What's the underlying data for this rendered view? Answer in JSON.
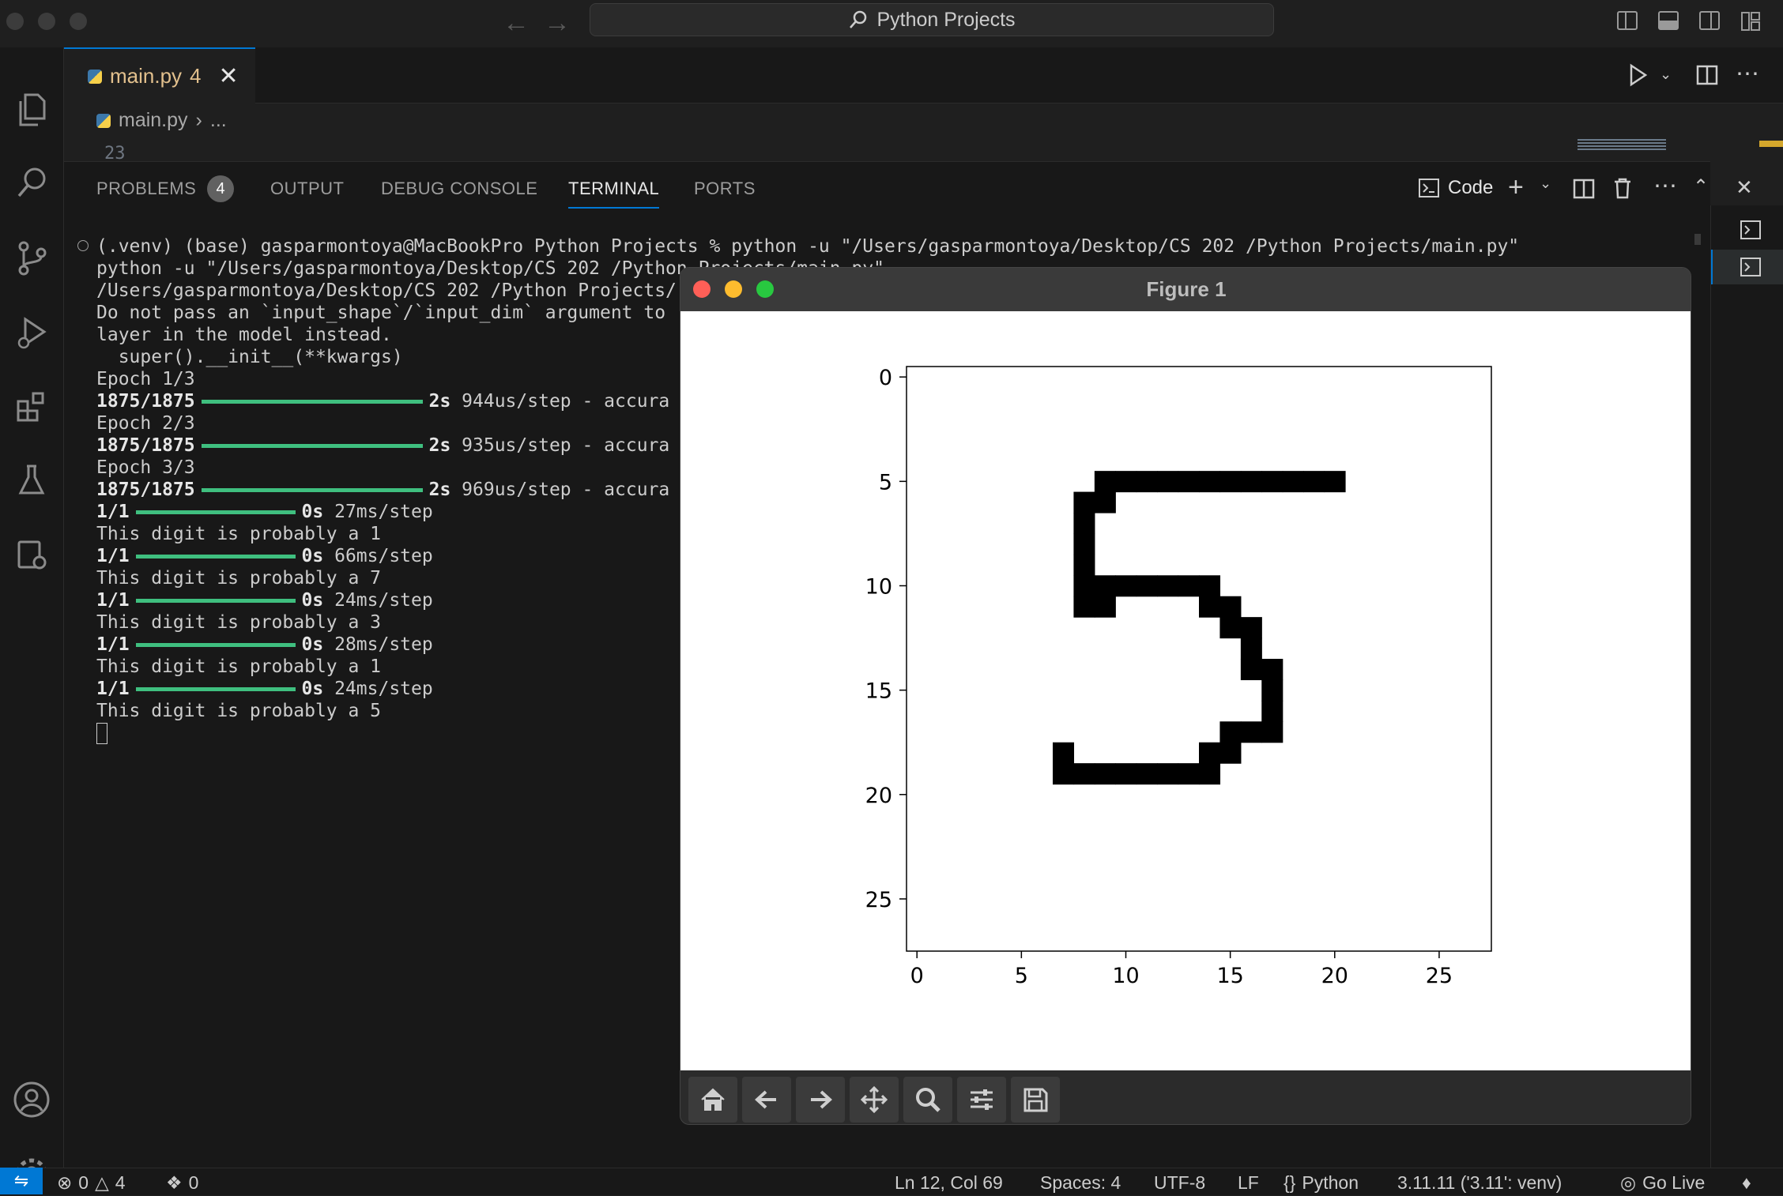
{
  "window": {
    "command_center": "Python Projects"
  },
  "editor": {
    "tab": {
      "label": "main.py",
      "problems": "4"
    },
    "breadcrumb": {
      "file": "main.py",
      "more": "..."
    },
    "line_number": "23"
  },
  "panel": {
    "tabs": [
      {
        "label": "PROBLEMS"
      },
      {
        "label": "OUTPUT"
      },
      {
        "label": "DEBUG CONSOLE"
      },
      {
        "label": "TERMINAL"
      },
      {
        "label": "PORTS"
      }
    ],
    "problems_count": "4",
    "terminal_profile": "Code",
    "terminal_lines": [
      {
        "text": "(.venv) (base) gasparmontoya@MacBookPro Python Projects % python -u \"/Users/gasparmontoya/Desktop/CS 202 /Python Projects/main.py\""
      },
      {
        "text": "python -u \"/Users/gasparmontoya/Desktop/CS 202 /Python Projects/main.py\""
      },
      {
        "text": "/Users/gasparmontoya/Desktop/CS 202 /Python Projects/"
      },
      {
        "text": "Do not pass an `input_shape`/`input_dim` argument to"
      },
      {
        "text": "layer in the model instead."
      },
      {
        "text": "  super().__init__(**kwargs)"
      },
      {
        "text": "Epoch 1/3"
      }
    ],
    "progress_lines": [
      {
        "count": "1875/1875",
        "time": "2s",
        "rate": "944us/step - accura",
        "fraction": 1.0,
        "wide": true
      },
      {
        "epoch": "Epoch 2/3"
      },
      {
        "count": "1875/1875",
        "time": "2s",
        "rate": "935us/step - accura",
        "fraction": 1.0,
        "wide": true
      },
      {
        "epoch": "Epoch 3/3"
      },
      {
        "count": "1875/1875",
        "time": "2s",
        "rate": "969us/step - accura",
        "fraction": 1.0,
        "wide": true
      },
      {
        "count": "1/1",
        "time": "0s",
        "rate": "27ms/step",
        "fraction": 1.0,
        "wide": false
      },
      {
        "result": "This digit is probably a 1"
      },
      {
        "count": "1/1",
        "time": "0s",
        "rate": "66ms/step",
        "fraction": 1.0,
        "wide": false
      },
      {
        "result": "This digit is probably a 7"
      },
      {
        "count": "1/1",
        "time": "0s",
        "rate": "24ms/step",
        "fraction": 1.0,
        "wide": false
      },
      {
        "result": "This digit is probably a 3"
      },
      {
        "count": "1/1",
        "time": "0s",
        "rate": "28ms/step",
        "fraction": 1.0,
        "wide": false
      },
      {
        "result": "This digit is probably a 1"
      },
      {
        "count": "1/1",
        "time": "0s",
        "rate": "24ms/step",
        "fraction": 1.0,
        "wide": false
      },
      {
        "result": "This digit is probably a 5"
      }
    ]
  },
  "figure": {
    "title": "Figure 1",
    "toolbar": [
      "home-icon",
      "back-icon",
      "forward-icon",
      "pan-icon",
      "zoom-icon",
      "configure-subplots-icon",
      "save-icon"
    ]
  },
  "chart_data": {
    "type": "heatmap",
    "title": "",
    "xlabel": "",
    "ylabel": "",
    "xlim": [
      -0.5,
      27.5
    ],
    "ylim": [
      27.5,
      -0.5
    ],
    "xticks": [
      "0",
      "5",
      "10",
      "15",
      "20",
      "25"
    ],
    "yticks": [
      "0",
      "5",
      "10",
      "15",
      "20",
      "25"
    ],
    "colormap": "binary (white=0, black=1)",
    "ink_pixels": [
      [
        5,
        9
      ],
      [
        5,
        10
      ],
      [
        5,
        11
      ],
      [
        5,
        12
      ],
      [
        5,
        13
      ],
      [
        5,
        14
      ],
      [
        5,
        15
      ],
      [
        5,
        16
      ],
      [
        5,
        17
      ],
      [
        5,
        18
      ],
      [
        5,
        19
      ],
      [
        5,
        20
      ],
      [
        6,
        8
      ],
      [
        6,
        9
      ],
      [
        7,
        8
      ],
      [
        8,
        8
      ],
      [
        9,
        8
      ],
      [
        10,
        8
      ],
      [
        10,
        9
      ],
      [
        10,
        10
      ],
      [
        10,
        11
      ],
      [
        10,
        12
      ],
      [
        10,
        13
      ],
      [
        10,
        14
      ],
      [
        11,
        8
      ],
      [
        11,
        9
      ],
      [
        11,
        14
      ],
      [
        11,
        15
      ],
      [
        12,
        15
      ],
      [
        12,
        16
      ],
      [
        13,
        16
      ],
      [
        14,
        16
      ],
      [
        14,
        17
      ],
      [
        15,
        17
      ],
      [
        16,
        17
      ],
      [
        17,
        15
      ],
      [
        17,
        16
      ],
      [
        17,
        17
      ],
      [
        18,
        7
      ],
      [
        18,
        14
      ],
      [
        18,
        15
      ],
      [
        19,
        7
      ],
      [
        19,
        8
      ],
      [
        19,
        9
      ],
      [
        19,
        10
      ],
      [
        19,
        11
      ],
      [
        19,
        12
      ],
      [
        19,
        13
      ],
      [
        19,
        14
      ]
    ]
  },
  "statusbar": {
    "errors": "0",
    "warnings": "4",
    "ports": "0",
    "position": "Ln 12, Col 69",
    "spaces": "Spaces: 4",
    "encoding": "UTF-8",
    "eol": "LF",
    "language": "Python",
    "interpreter": "3.11.11 ('3.11': venv)",
    "golive": "Go Live"
  },
  "colors": {
    "accent": "#0078d4",
    "progress": "#3fbf7f",
    "tab_label": "#e2c08d"
  }
}
